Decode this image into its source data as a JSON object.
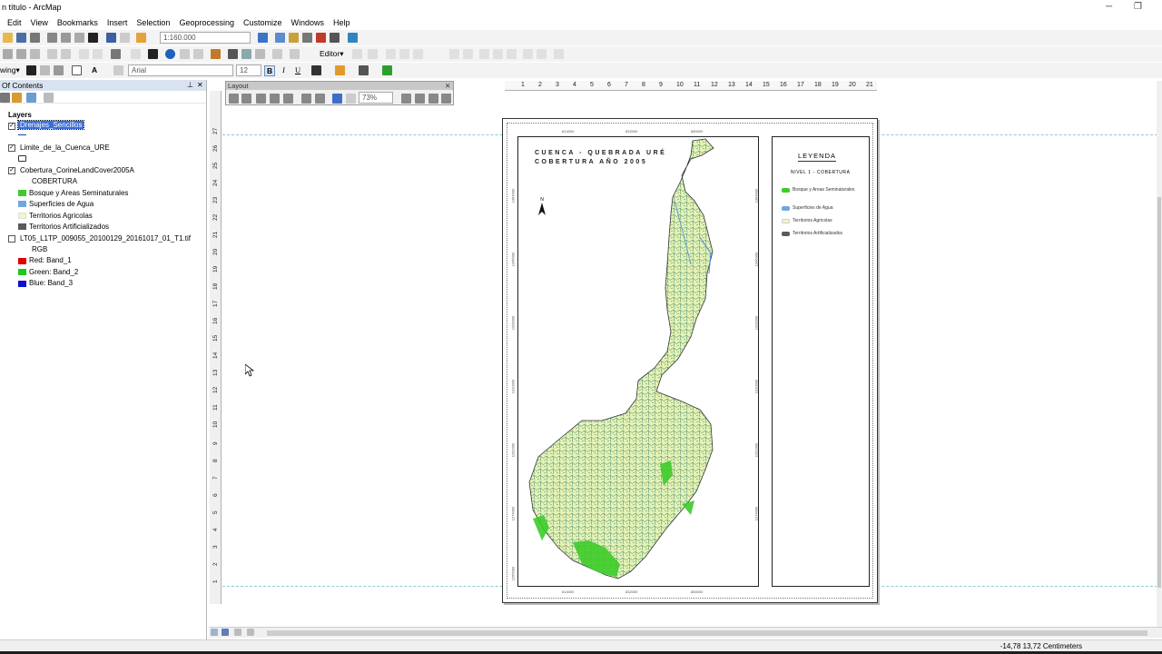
{
  "window": {
    "title": "n título - ArcMap",
    "minimize": "─",
    "restore": "❐"
  },
  "menu": [
    "Edit",
    "View",
    "Bookmarks",
    "Insert",
    "Selection",
    "Geoprocessing",
    "Customize",
    "Windows",
    "Help"
  ],
  "toolbar": {
    "scale": "1:160.000",
    "editor": "Editor▾",
    "drawing": "wing▾",
    "font": "Arial",
    "font_size": "12",
    "bold": "B",
    "italic": "I",
    "underline": "U"
  },
  "toc": {
    "title": "Of Contents",
    "pin": "⊥",
    "close": "✕",
    "root": "Layers",
    "layers": [
      {
        "name": "Drenajes_Sencillos",
        "checked": true,
        "selected": true
      },
      {
        "name": "Limite_de_la_Cuenca_URE",
        "checked": true
      },
      {
        "name": "Cobertura_CorineLandCover2005A",
        "checked": true,
        "field": "COBERTURA"
      },
      {
        "name": "LT05_L1TP_009055_20100129_20161017_01_T1.tif",
        "checked": false,
        "field": "RGB"
      }
    ],
    "cobertura_classes": [
      {
        "label": "Bosque y Areas Seminaturales",
        "color": "#3ccc28"
      },
      {
        "label": "Superficies de Agua",
        "color": "#6fa8dc"
      },
      {
        "label": "Territorios Agricolas",
        "color": "#f1f7c8"
      },
      {
        "label": "Territorios Artificializados",
        "color": "#5a5a5a"
      }
    ],
    "rgb_bands": [
      {
        "label": "Red:    Band_1",
        "color": "#e00000"
      },
      {
        "label": "Green: Band_2",
        "color": "#1ec81e"
      },
      {
        "label": "Blue:   Band_3",
        "color": "#1010d0"
      }
    ]
  },
  "layout_toolbar": {
    "title": "Layout",
    "zoom": "73%",
    "close": "✕"
  },
  "ruler": {
    "h": [
      "1",
      "2",
      "3",
      "4",
      "5",
      "6",
      "7",
      "8",
      "9",
      "10",
      "11",
      "12",
      "13",
      "14",
      "15",
      "16",
      "17",
      "18",
      "19",
      "20",
      "21"
    ],
    "v": [
      "27",
      "26",
      "25",
      "24",
      "23",
      "22",
      "21",
      "20",
      "19",
      "18",
      "17",
      "16",
      "15",
      "14",
      "13",
      "12",
      "11",
      "10",
      "9",
      "8",
      "7",
      "6",
      "5",
      "4",
      "3",
      "2",
      "1"
    ]
  },
  "map": {
    "title_line1": "CUENCA - QUEBRADA URÉ",
    "title_line2": "COBERTURA AÑO 2005",
    "north": "N",
    "x_coords": [
      "814000",
      "832000",
      "850000"
    ],
    "y_coords": [
      "1364000",
      "1346000",
      "1328000",
      "1310000",
      "1292000",
      "1274000",
      "1256000",
      "1238000"
    ]
  },
  "legend": {
    "title": "LEYENDA",
    "subtitle": "NIVEL 1 - COBERTURA",
    "items": [
      {
        "label": "Bosque y Areas Seminaturales",
        "color": "#3ccc28"
      },
      {
        "label": "Superficies de Agua",
        "color": "#6fa8dc"
      },
      {
        "label": "Territorios Agricolas",
        "color": "#f1f7c8"
      },
      {
        "label": "Territorios Artificializados",
        "color": "#5a5a5a"
      }
    ]
  },
  "status": {
    "coords": "-14,78  13,72 Centimeters"
  }
}
